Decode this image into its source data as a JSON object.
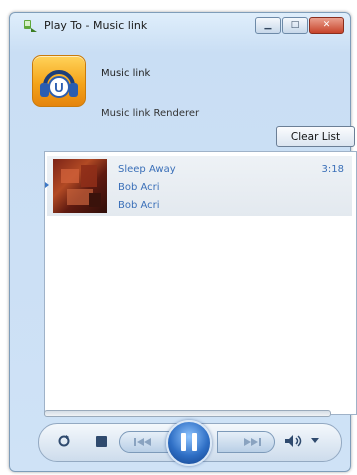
{
  "window": {
    "title": "Play To - Music link",
    "controls": [
      "minimize",
      "maximize",
      "close"
    ]
  },
  "device": {
    "name": "Music link",
    "subtitle": "Music link Renderer",
    "icon": "headphones-u-icon"
  },
  "toolbar": {
    "clear_list_label": "Clear List"
  },
  "playlist": {
    "items": [
      {
        "title": "Sleep Away",
        "artist": "Bob Acri",
        "album_artist": "Bob Acri",
        "duration": "3:18"
      }
    ]
  },
  "player": {
    "buttons": [
      "repeat-icon",
      "stop-icon",
      "previous-icon",
      "pause-icon",
      "next-icon",
      "volume-icon",
      "dropdown-caret-icon"
    ],
    "state": "playing"
  },
  "colors": {
    "accent": "#3a6fb8",
    "window_frame": "#c9def4",
    "close_button": "#c7432a"
  }
}
